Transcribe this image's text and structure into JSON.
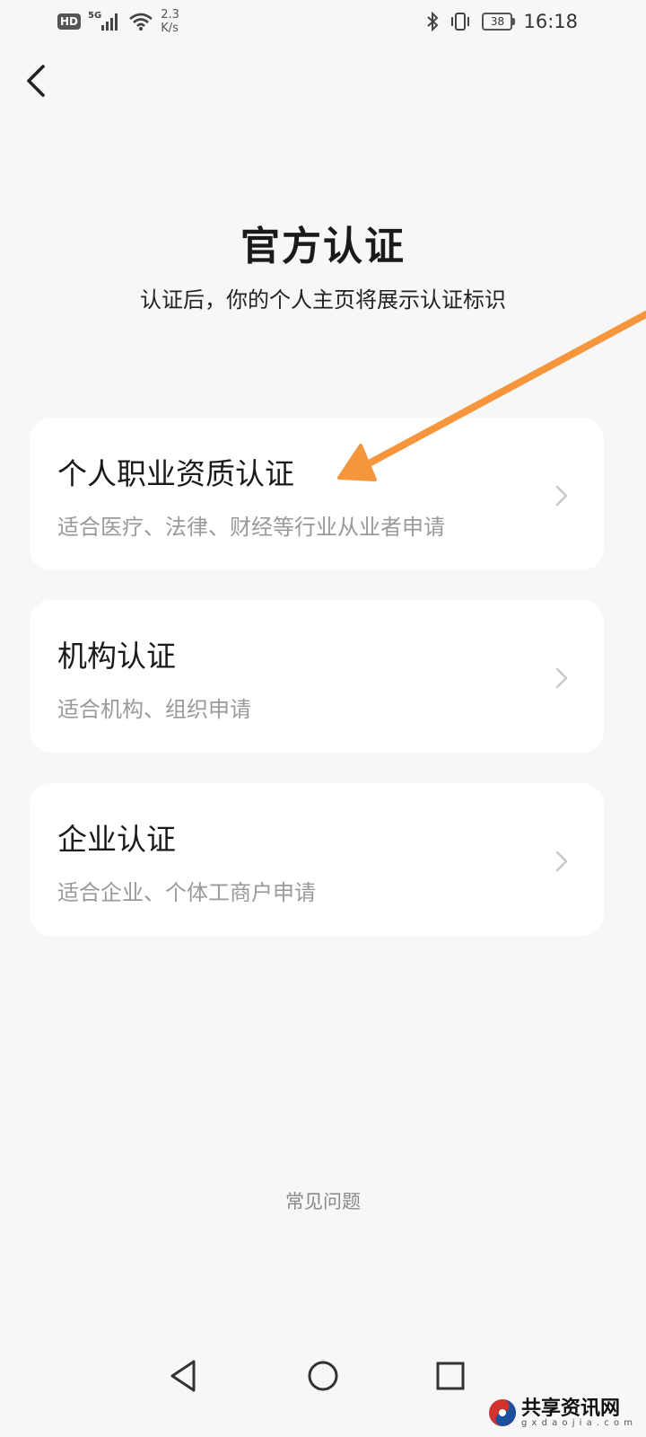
{
  "status_bar": {
    "hd_badge": "HD",
    "network_type": "5G",
    "speed_value": "2.3",
    "speed_unit": "K/s",
    "battery_level": "38",
    "time": "16:18"
  },
  "header": {
    "title": "官方认证",
    "subtitle": "认证后，你的个人主页将展示认证标识"
  },
  "options": [
    {
      "title": "个人职业资质认证",
      "description": "适合医疗、法律、财经等行业从业者申请"
    },
    {
      "title": "机构认证",
      "description": "适合机构、组织申请"
    },
    {
      "title": "企业认证",
      "description": "适合企业、个体工商户申请"
    }
  ],
  "faq_label": "常见问题",
  "watermark": {
    "title": "共享资讯网",
    "domain": "g x d a o j i a . c o m"
  },
  "colors": {
    "background": "#f7f7f7",
    "card_background": "#ffffff",
    "annotation_arrow": "#f5963c",
    "secondary_text": "#9a9a9a"
  },
  "icons": {
    "back": "chevron-left-icon",
    "card_arrow": "chevron-right-icon",
    "nav_back": "triangle-back-icon",
    "nav_home": "circle-home-icon",
    "nav_recent": "square-recents-icon"
  }
}
